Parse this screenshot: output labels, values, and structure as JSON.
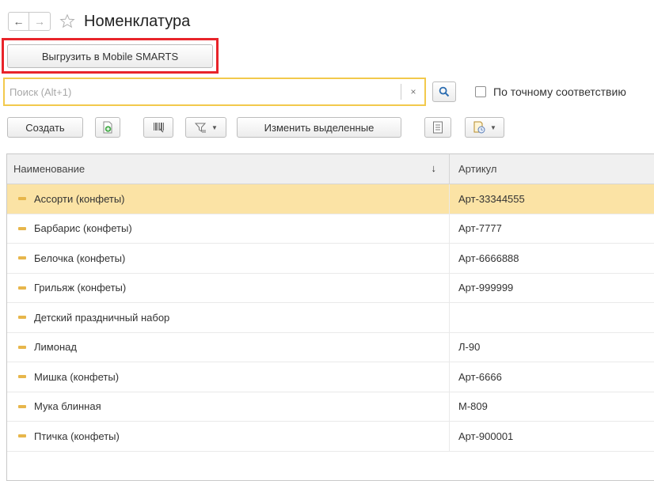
{
  "window": {
    "title": "Номенклатура"
  },
  "nav": {
    "back_icon": "←",
    "forward_icon": "→",
    "favorite_icon": "star-outline"
  },
  "export_button": {
    "label": "Выгрузить в Mobile SMARTS",
    "highlight_color": "#e8242a"
  },
  "search": {
    "value": "",
    "placeholder": "Поиск (Alt+1)",
    "clear_icon": "×",
    "exact_match_label": "По точному соответствию",
    "exact_match_checked": false,
    "border_color": "#f2c94c"
  },
  "toolbar": {
    "create_label": "Создать",
    "edit_selected_label": "Изменить выделенные"
  },
  "table": {
    "columns": [
      "Наименование",
      "Артикул"
    ],
    "sort_indicator": "↓",
    "selected_color": "#fbe3a5",
    "rows": [
      {
        "name": "Ассорти (конфеты)",
        "article": "Арт-33344555",
        "selected": true
      },
      {
        "name": "Барбарис (конфеты)",
        "article": "Арт-7777",
        "selected": false
      },
      {
        "name": "Белочка (конфеты)",
        "article": "Арт-6666888",
        "selected": false
      },
      {
        "name": "Грильяж (конфеты)",
        "article": "Арт-999999",
        "selected": false
      },
      {
        "name": "Детский праздничный набор",
        "article": "",
        "selected": false
      },
      {
        "name": "Лимонад",
        "article": "Л-90",
        "selected": false
      },
      {
        "name": "Мишка (конфеты)",
        "article": "Арт-6666",
        "selected": false
      },
      {
        "name": "Мука блинная",
        "article": "М-809",
        "selected": false
      },
      {
        "name": "Птичка (конфеты)",
        "article": "Арт-900001",
        "selected": false
      }
    ]
  }
}
